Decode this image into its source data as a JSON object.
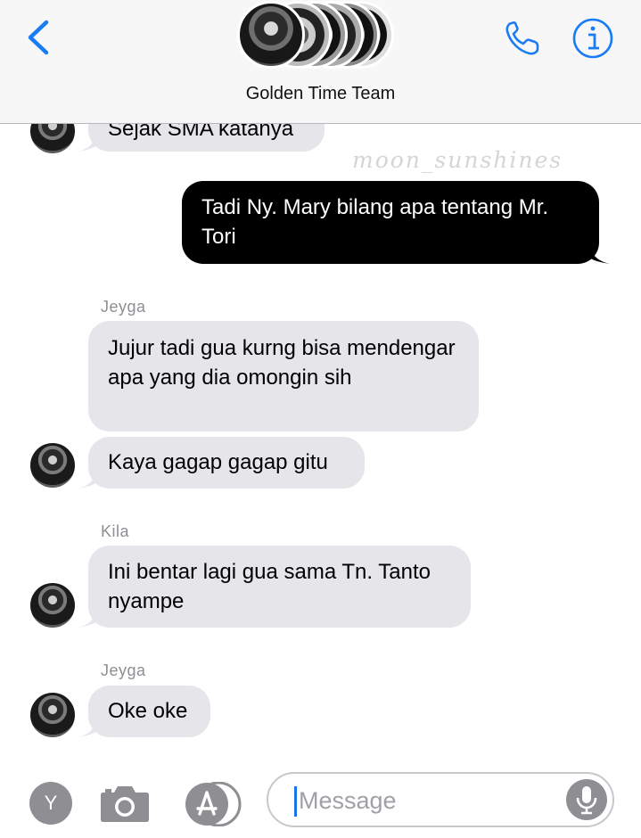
{
  "header": {
    "title": "Golden Time Team",
    "back_icon": "chevron-left-icon",
    "phone_icon": "phone-icon",
    "info_icon": "info-icon",
    "accent_color": "#1a7cf5"
  },
  "watermark": "moon_sunshines",
  "messages": [
    {
      "direction": "in",
      "text": "Sejak SMA katanya"
    },
    {
      "direction": "out",
      "text": "Tadi Ny. Mary bilang apa tentang Mr. Tori"
    },
    {
      "direction": "in",
      "sender": "Jeyga",
      "text": "Jujur tadi gua kurng bisa mendengar apa yang dia omongin sih"
    },
    {
      "direction": "in",
      "text": "Kaya gagap gagap gitu"
    },
    {
      "direction": "in",
      "sender": "Kila",
      "text": "Ini bentar lagi gua sama Tn. Tanto nyampe"
    },
    {
      "direction": "in",
      "sender": "Jeyga",
      "text": "Oke oke"
    }
  ],
  "toolbar": {
    "avatar_letter": "Y",
    "camera_icon": "camera-icon",
    "appstore_icon": "app-store-icon",
    "input_placeholder": "Message",
    "mic_icon": "microphone-icon"
  }
}
